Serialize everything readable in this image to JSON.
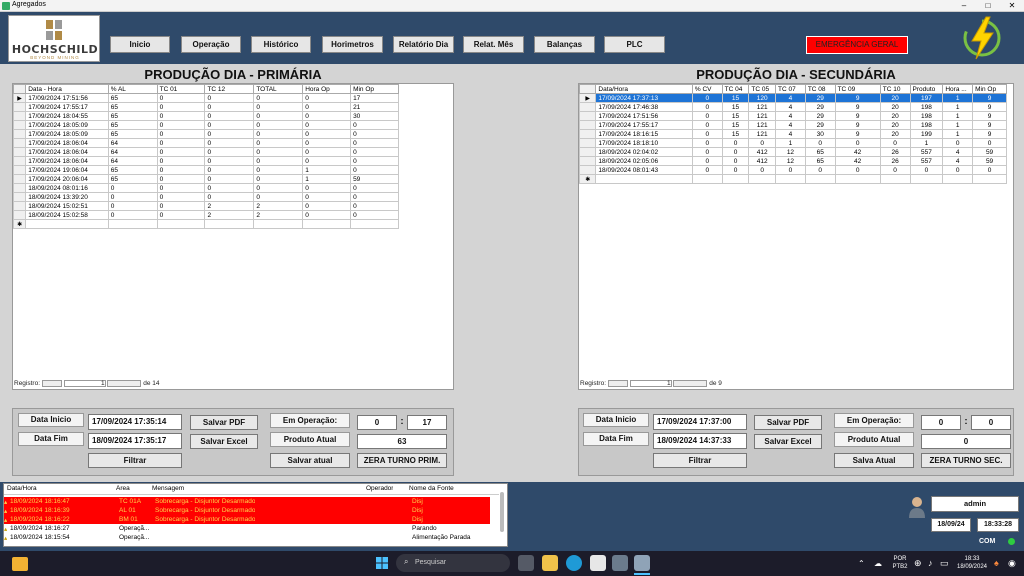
{
  "window": {
    "title": "Agregados",
    "min": "–",
    "max": "□",
    "close": "✕"
  },
  "logo": {
    "name": "HOCHSCHILD",
    "tagline": "BEYOND MINING"
  },
  "nav": [
    "Inicio",
    "Operação",
    "Histórico",
    "Horimetros",
    "Relatório Dia",
    "Relat. Mês",
    "Balanças",
    "PLC"
  ],
  "emergency": "EMERGÊNCIA GERAL",
  "colors": {
    "header": "#2f4a6a",
    "emergency": "#ff0000",
    "alarm_row": "#ff0000",
    "selection": "#1e74d6"
  },
  "primary": {
    "title": "PRODUÇÃO DIA - PRIMÁRIA",
    "columns": [
      "Data - Hora",
      "% AL",
      "TC 01",
      "TC 12",
      "TOTAL",
      "Hora Op",
      "Min Op"
    ],
    "rows": [
      [
        "17/09/2024 17:51:56",
        "65",
        "0",
        "0",
        "0",
        "0",
        "17"
      ],
      [
        "17/09/2024 17:55:17",
        "65",
        "0",
        "0",
        "0",
        "0",
        "21"
      ],
      [
        "17/09/2024 18:04:55",
        "65",
        "0",
        "0",
        "0",
        "0",
        "30"
      ],
      [
        "17/09/2024 18:05:09",
        "65",
        "0",
        "0",
        "0",
        "0",
        "0"
      ],
      [
        "17/09/2024 18:05:09",
        "65",
        "0",
        "0",
        "0",
        "0",
        "0"
      ],
      [
        "17/09/2024 18:06:04",
        "64",
        "0",
        "0",
        "0",
        "0",
        "0"
      ],
      [
        "17/09/2024 18:06:04",
        "64",
        "0",
        "0",
        "0",
        "0",
        "0"
      ],
      [
        "17/09/2024 18:06:04",
        "64",
        "0",
        "0",
        "0",
        "0",
        "0"
      ],
      [
        "17/09/2024 19:06:04",
        "65",
        "0",
        "0",
        "0",
        "1",
        "0"
      ],
      [
        "17/09/2024 20:06:04",
        "65",
        "0",
        "0",
        "0",
        "1",
        "59"
      ],
      [
        "18/09/2024 08:01:16",
        "0",
        "0",
        "0",
        "0",
        "0",
        "0"
      ],
      [
        "18/09/2024 13:39:20",
        "0",
        "0",
        "0",
        "0",
        "0",
        "0"
      ],
      [
        "18/09/2024 15:02:51",
        "0",
        "0",
        "2",
        "2",
        "0",
        "0"
      ],
      [
        "18/09/2024 15:02:58",
        "0",
        "0",
        "2",
        "2",
        "0",
        "0"
      ]
    ],
    "record_label": "Registro:",
    "record_current": "1",
    "record_total": "de 14",
    "data_inicio_label": "Data Inicio",
    "data_inicio": "17/09/2024 17:35:14",
    "data_fim_label": "Data Fim",
    "data_fim": "18/09/2024 17:35:17",
    "salvar_pdf": "Salvar PDF",
    "salvar_excel": "Salvar Excel",
    "filtrar": "Filtrar",
    "em_operacao_label": "Em Operação:",
    "op_hours": "0",
    "op_sep": ":",
    "op_minutes": "17",
    "produto_label": "Produto Atual",
    "produto": "63",
    "salvar_atual": "Salvar atual",
    "zera": "ZERA TURNO PRIM."
  },
  "secondary": {
    "title": "PRODUÇÃO DIA - SECUNDÁRIA",
    "columns": [
      "Data/Hora",
      "% CV",
      "TC 04",
      "TC 05",
      "TC 07",
      "TC 08",
      "TC 09",
      "TC 10",
      "Produto",
      "Hora ...",
      "Min Op"
    ],
    "rows": [
      [
        "17/09/2024 17:37:13",
        "0",
        "15",
        "120",
        "4",
        "29",
        "9",
        "20",
        "197",
        "1",
        "9"
      ],
      [
        "17/09/2024 17:46:38",
        "0",
        "15",
        "121",
        "4",
        "29",
        "9",
        "20",
        "198",
        "1",
        "9"
      ],
      [
        "17/09/2024 17:51:56",
        "0",
        "15",
        "121",
        "4",
        "29",
        "9",
        "20",
        "198",
        "1",
        "9"
      ],
      [
        "17/09/2024 17:55:17",
        "0",
        "15",
        "121",
        "4",
        "29",
        "9",
        "20",
        "198",
        "1",
        "9"
      ],
      [
        "17/09/2024 18:16:15",
        "0",
        "15",
        "121",
        "4",
        "30",
        "9",
        "20",
        "199",
        "1",
        "9"
      ],
      [
        "17/09/2024 18:18:10",
        "0",
        "0",
        "0",
        "1",
        "0",
        "0",
        "0",
        "1",
        "0",
        "0"
      ],
      [
        "18/09/2024 02:04:02",
        "0",
        "0",
        "412",
        "12",
        "65",
        "42",
        "26",
        "557",
        "4",
        "59"
      ],
      [
        "18/09/2024 02:05:06",
        "0",
        "0",
        "412",
        "12",
        "65",
        "42",
        "26",
        "557",
        "4",
        "59"
      ],
      [
        "18/09/2024 08:01:43",
        "0",
        "0",
        "0",
        "0",
        "0",
        "0",
        "0",
        "0",
        "0",
        "0"
      ]
    ],
    "record_label": "Registro:",
    "record_current": "1",
    "record_total": "de 9",
    "data_inicio_label": "Data Inicio",
    "data_inicio": "17/09/2024 17:37:00",
    "data_fim_label": "Data Fim",
    "data_fim": "18/09/2024 14:37:33",
    "salvar_pdf": "Salvar PDF",
    "salvar_excel": "Salvar Excel",
    "filtrar": "Filtrar",
    "em_operacao_label": "Em Operação:",
    "op_hours": "0",
    "op_sep": ":",
    "op_minutes": "0",
    "produto_label": "Produto Atual",
    "produto": "0",
    "salvar_atual": "Salva Atual",
    "zera": "ZERA TURNO SEC."
  },
  "alarms": {
    "columns": [
      "Data/Hora",
      "Área",
      "Mensagem",
      "Operador",
      "Nome da Fonte"
    ],
    "rows": [
      {
        "time": "18/09/2024 18:16:47",
        "area": "TC 01A",
        "msg": "Sobrecarga - Disjuntor Desarmado",
        "op": "",
        "src": "Disj",
        "red": true
      },
      {
        "time": "18/09/2024 18:16:39",
        "area": "AL 01",
        "msg": "Sobrecarga - Disjuntor Desarmado",
        "op": "",
        "src": "Disj",
        "red": true
      },
      {
        "time": "18/09/2024 18:16:22",
        "area": "BM 01",
        "msg": "Sobrecarga - Disjuntor Desarmado",
        "op": "",
        "src": "Disj",
        "red": true
      },
      {
        "time": "18/09/2024 18:16:27",
        "area": "Operaçã...",
        "msg": "",
        "op": "",
        "src": "Parando",
        "red": false
      },
      {
        "time": "18/09/2024 18:15:54",
        "area": "Operaçã...",
        "msg": "",
        "op": "",
        "src": "Alimentação Parada",
        "red": false
      }
    ]
  },
  "user": {
    "name": "admin",
    "date": "18/09/24",
    "time": "18:33:28",
    "com": "COM"
  },
  "taskbar": {
    "search": "Pesquisar",
    "lang1": "POR",
    "lang2": "PTB2",
    "clock_time": "18:33",
    "clock_date": "18/09/2024"
  }
}
